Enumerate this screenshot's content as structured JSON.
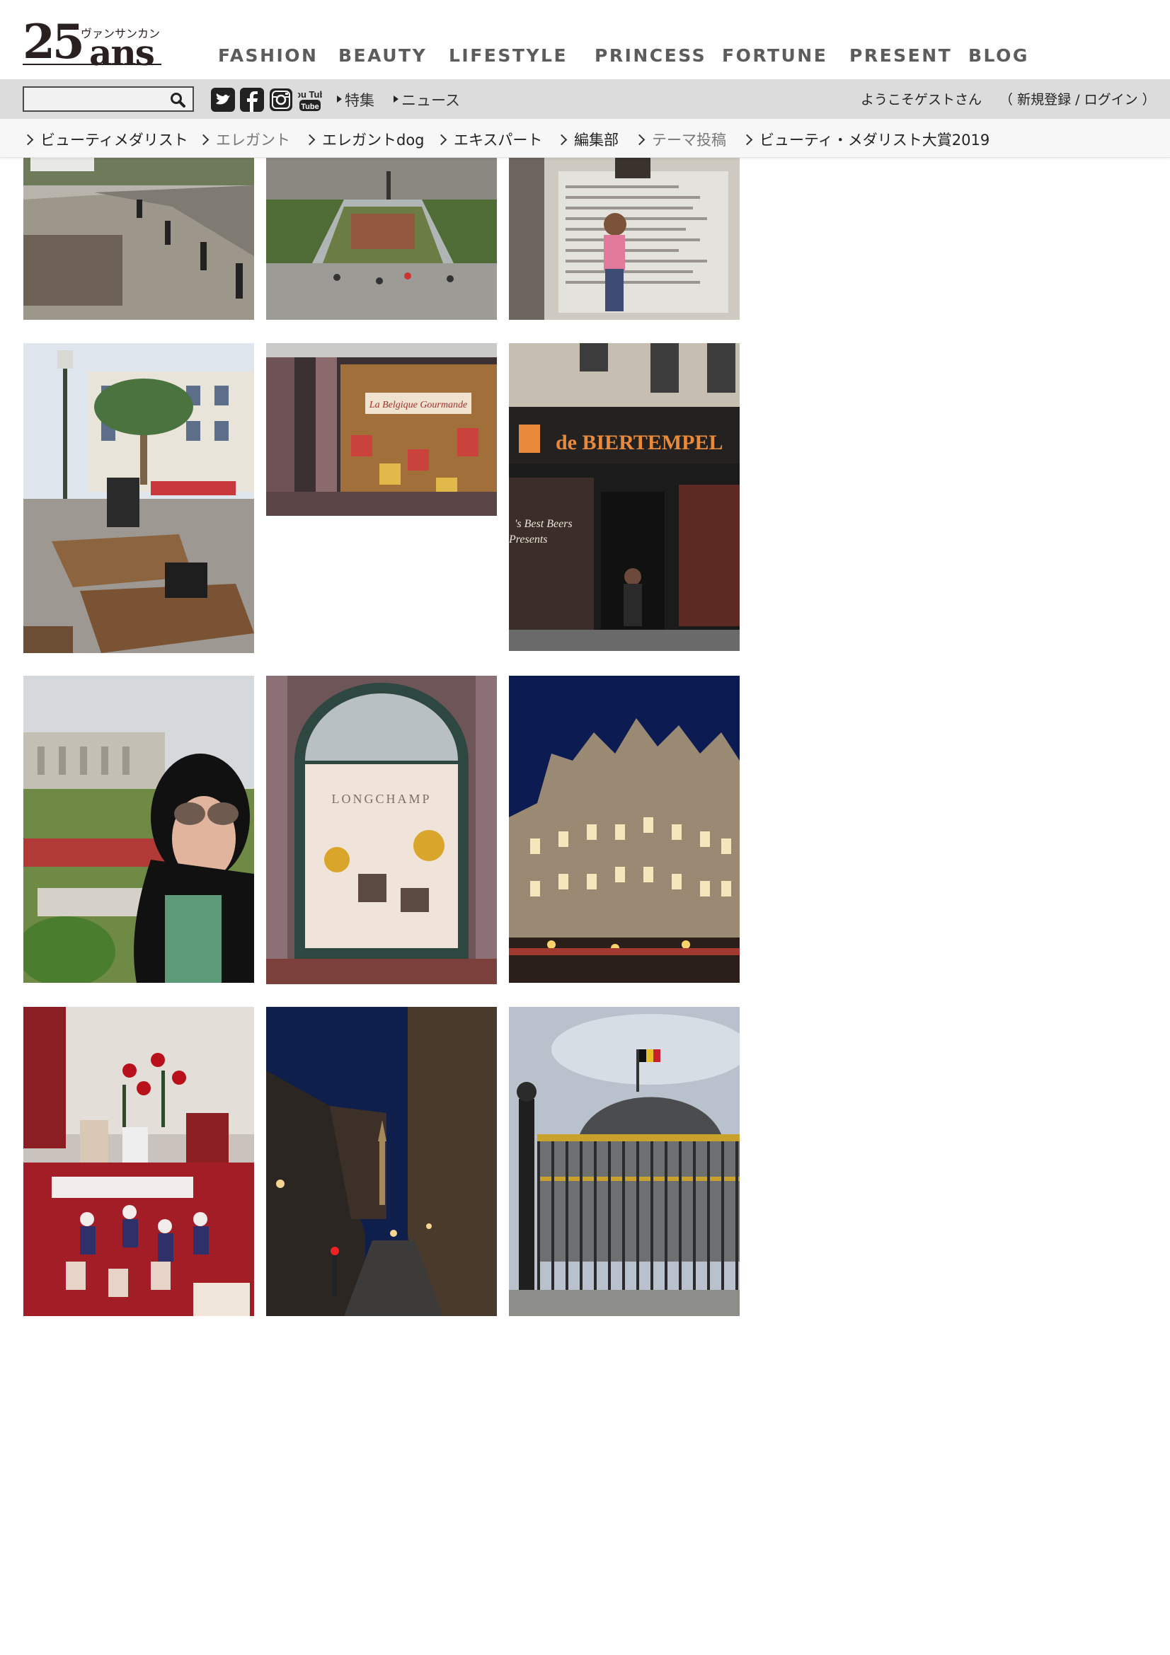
{
  "brand": {
    "logo_number": "25",
    "logo_word": "ans",
    "logo_kana": "ヴァンサンカン"
  },
  "main_nav": [
    "FASHION",
    "BEAUTY",
    "LIFESTYLE",
    "PRINCESS",
    "FORTUNE",
    "PRESENT",
    "BLOG"
  ],
  "utility": {
    "search_placeholder": "",
    "social_icons": [
      "twitter-icon",
      "facebook-icon",
      "instagram-icon",
      "youtube-icon"
    ],
    "youtube_label": "You Tube",
    "links": [
      "特集",
      "ニュース"
    ],
    "welcome": "ようこそゲストさん",
    "auth_open": "（",
    "register": "新規登録",
    "auth_sep": "/",
    "login": "ログイン",
    "auth_close": "）"
  },
  "sub_nav": [
    "ビューティメダリスト",
    "エレガント",
    "エレガントdog",
    "エキスパート",
    "編集部",
    "テーマ投稿",
    "ビューティ・メダリスト大賞2019"
  ],
  "photo_text": {
    "biertempel_sign": "de BIERTEMPEL",
    "best_beers": "'s Best Beers",
    "presents": "Presents",
    "longchamp": "LONGCHAMP",
    "gourmande": "La Belgique Gourmande"
  },
  "colors": {
    "utility_bar": "#dcdcdc",
    "subnav_bg": "#f7f7f7",
    "nav_text": "#5c5c5c"
  }
}
